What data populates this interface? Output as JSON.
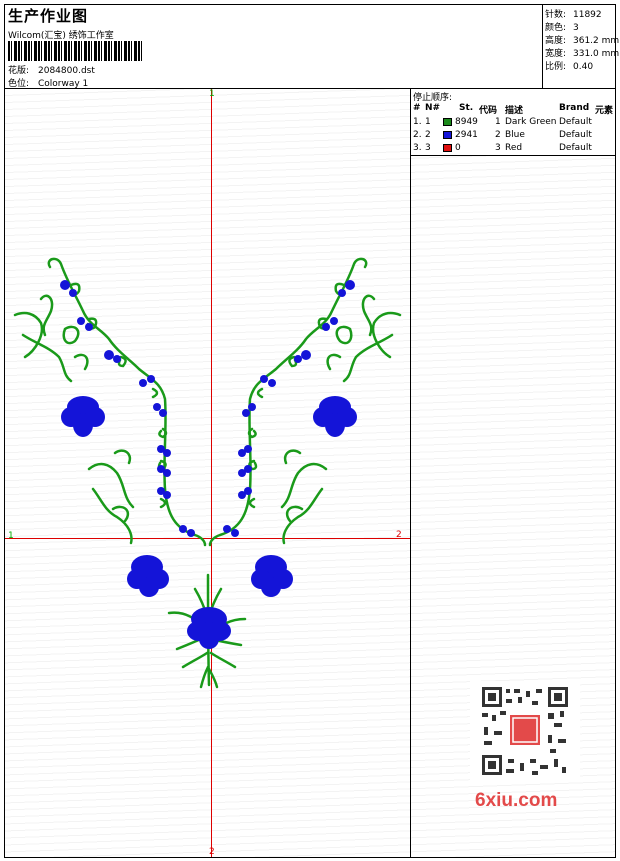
{
  "header": {
    "title": "生产作业图",
    "company": "Wilcom(汇宝) 绣饰工作室",
    "design_label": "花版:",
    "design_value": "2084800.dst",
    "colorway_label": "色位:",
    "colorway_value": "Colorway 1"
  },
  "stats": {
    "stitches_label": "针数:",
    "stitches_value": "11892",
    "colors_label": "颜色:",
    "colors_value": "3",
    "height_label": "高度:",
    "height_value": "361.2 mm",
    "width_label": "宽度:",
    "width_value": "331.0 mm",
    "scale_label": "比例:",
    "scale_value": "0.40"
  },
  "axes": {
    "top": "1",
    "left": "1",
    "right": "2",
    "bottom": "2"
  },
  "sequence": {
    "title": "停止顺序:",
    "columns": [
      "#",
      "N#",
      "St.",
      "代码",
      "描述",
      "Brand",
      "元素"
    ],
    "rows": [
      {
        "idx": "1.",
        "n": "1",
        "color": "#1a8a1a",
        "stitches": "8949",
        "code": "1",
        "desc": "Dark Green",
        "brand": "Default"
      },
      {
        "idx": "2.",
        "n": "2",
        "color": "#1414d8",
        "stitches": "2941",
        "code": "2",
        "desc": "Blue",
        "brand": "Default"
      },
      {
        "idx": "3.",
        "n": "3",
        "color": "#e01010",
        "stitches": "0",
        "code": "3",
        "desc": "Red",
        "brand": "Default"
      }
    ]
  },
  "watermark": "6xiu.com",
  "colors": {
    "green": "#1a9a1a",
    "blue": "#1414d8",
    "axis": "#dd0000"
  }
}
